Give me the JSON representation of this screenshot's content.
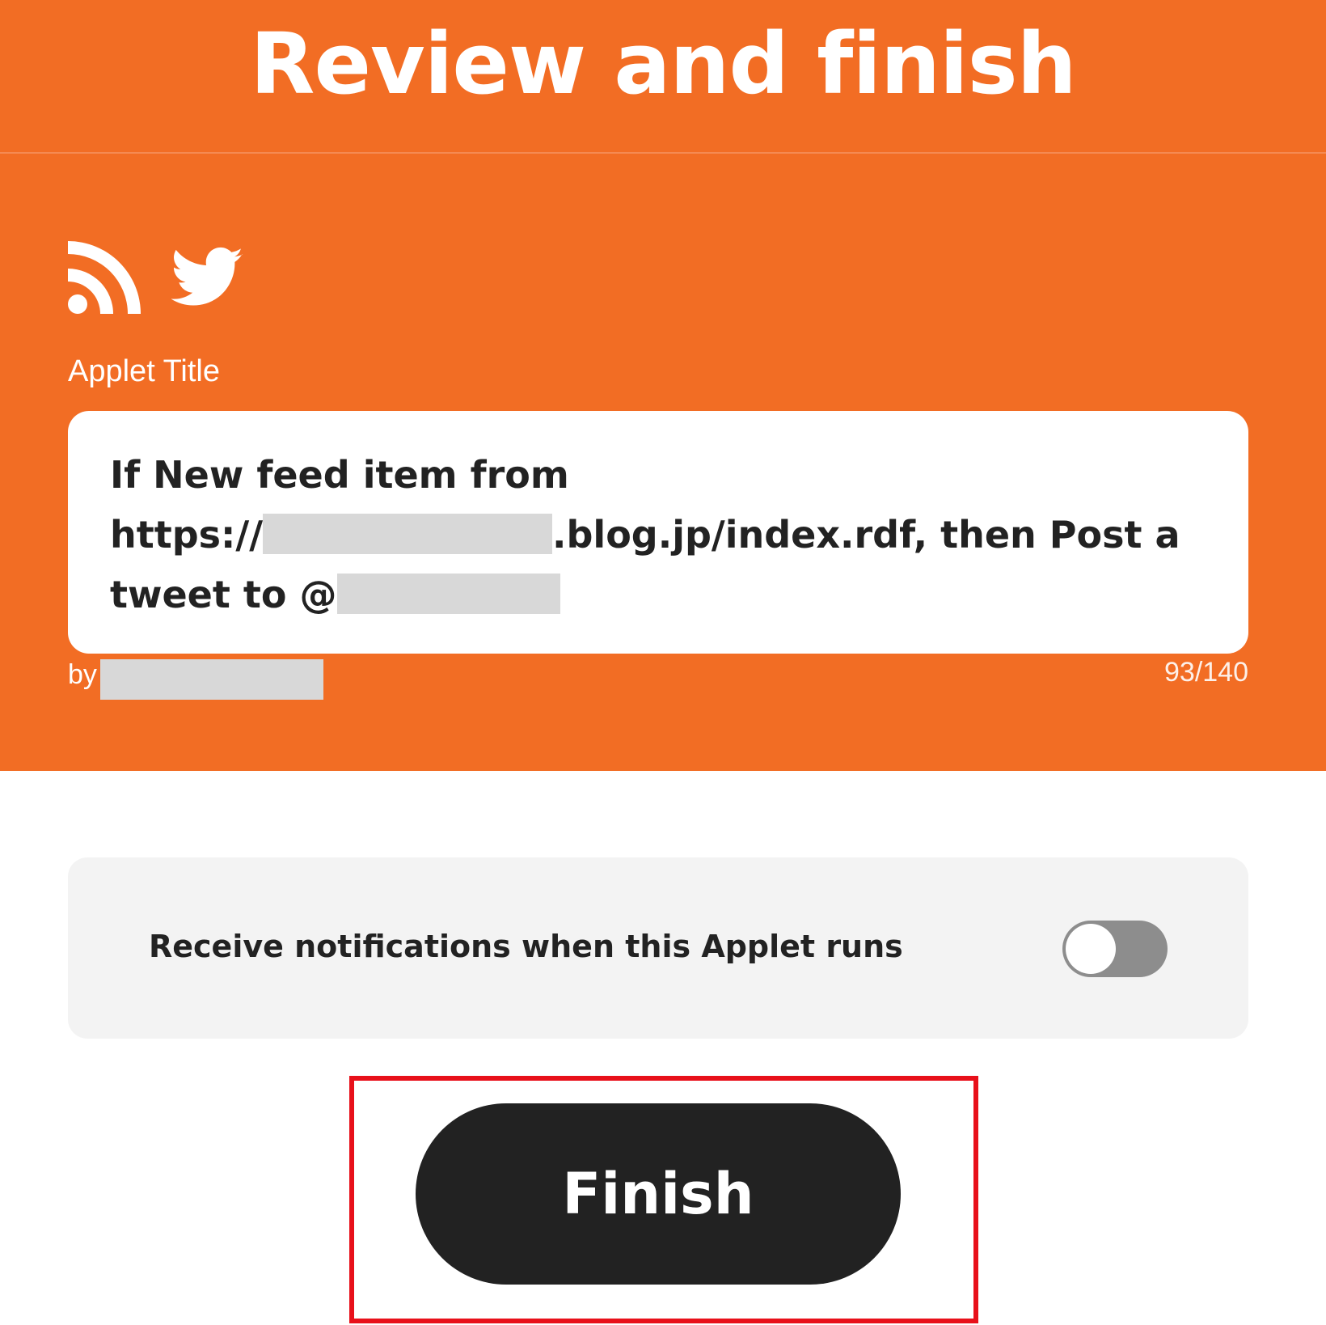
{
  "header": {
    "title": "Review and finish"
  },
  "applet": {
    "icons": [
      "rss-icon",
      "twitter-icon"
    ],
    "title_label": "Applet Title",
    "title_parts": {
      "line1": "If New feed item from",
      "url_prefix": "https://",
      "url_suffix": ".blog.jp/index.rdf, then Post a",
      "line3_prefix": "tweet to @"
    },
    "byline_prefix": "by",
    "char_count": "93/140"
  },
  "notifications": {
    "label": "Receive notifications when this Applet runs",
    "enabled": false
  },
  "actions": {
    "finish_label": "Finish"
  },
  "colors": {
    "brand_orange": "#f26d24",
    "button_dark": "#222222",
    "highlight_red": "#e8101a",
    "toggle_off": "#8d8d8d"
  }
}
